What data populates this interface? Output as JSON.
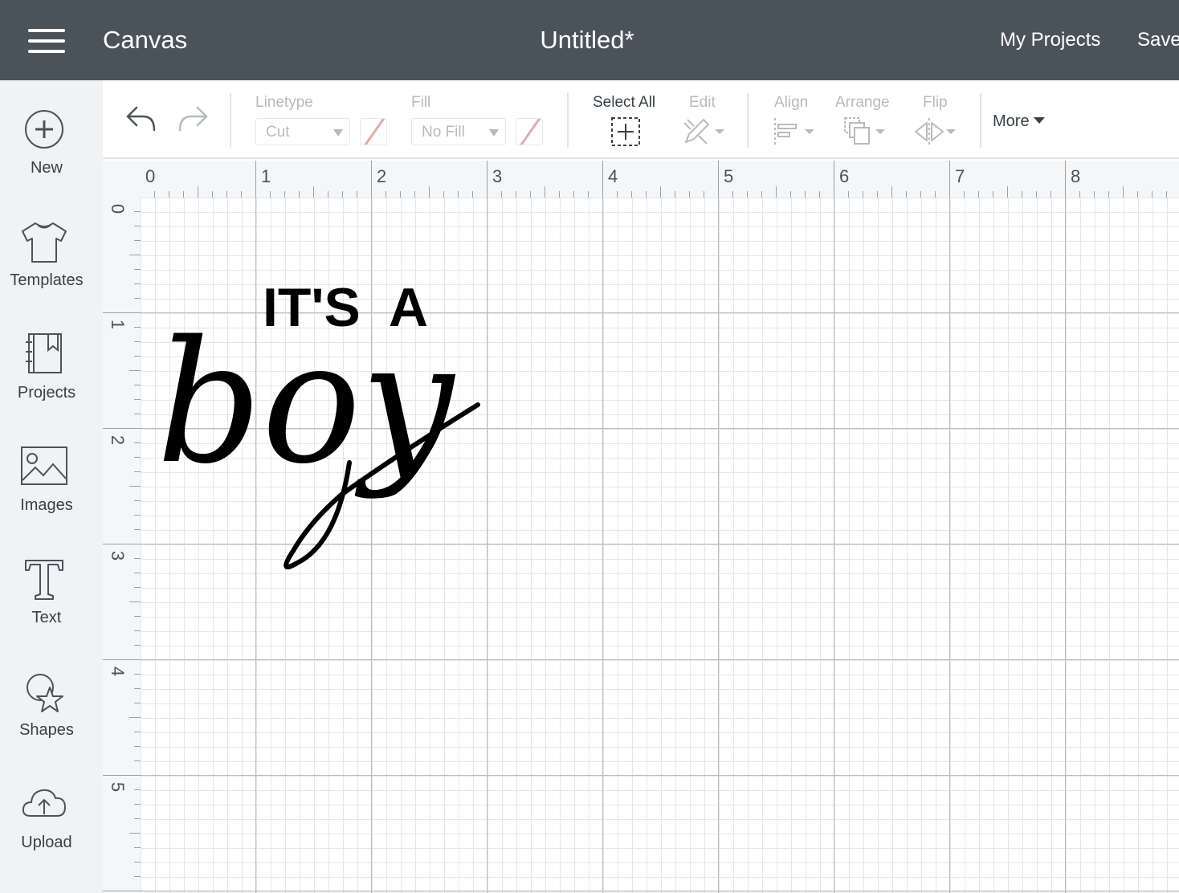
{
  "header": {
    "app_title": "Canvas",
    "doc_title": "Untitled*",
    "my_projects": "My Projects",
    "save": "Save"
  },
  "sidebar": {
    "items": [
      {
        "label": "New",
        "icon": "plus-circle-icon"
      },
      {
        "label": "Templates",
        "icon": "tshirt-icon"
      },
      {
        "label": "Projects",
        "icon": "bookmark-notebook-icon"
      },
      {
        "label": "Images",
        "icon": "image-icon"
      },
      {
        "label": "Text",
        "icon": "text-t-icon"
      },
      {
        "label": "Shapes",
        "icon": "shapes-icon"
      },
      {
        "label": "Upload",
        "icon": "cloud-upload-icon"
      }
    ]
  },
  "toolbar": {
    "linetype_label": "Linetype",
    "linetype_value": "Cut",
    "fill_label": "Fill",
    "fill_value": "No Fill",
    "select_all": "Select All",
    "edit": "Edit",
    "align": "Align",
    "arrange": "Arrange",
    "flip": "Flip",
    "more": "More"
  },
  "rulers": {
    "horizontal": [
      "0",
      "1",
      "2",
      "3",
      "4",
      "5",
      "6",
      "7",
      "8"
    ],
    "vertical": [
      "0",
      "1",
      "2",
      "3",
      "4",
      "5"
    ]
  },
  "design": {
    "line1": "IT'S  A",
    "line2": "boy"
  },
  "colors": {
    "topbar": "#4b535a",
    "sidebar": "#f1f2f3",
    "disabled": "#b7bbbf",
    "swatch_slash": "#e9a7a7"
  }
}
